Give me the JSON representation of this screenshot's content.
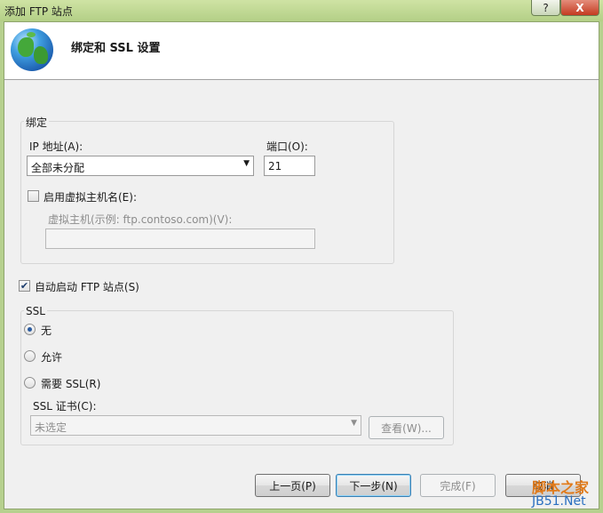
{
  "window": {
    "title": "添加 FTP 站点",
    "help_label": "?",
    "close_label": "X"
  },
  "header": {
    "title": "绑定和 SSL 设置"
  },
  "binding": {
    "group_label": "绑定",
    "ip_label": "IP 地址(A):",
    "ip_value": "全部未分配",
    "port_label": "端口(O):",
    "port_value": "21",
    "enable_virtual_host_label": "启用虚拟主机名(E):",
    "enable_virtual_host_checked": false,
    "virtual_host_label": "虚拟主机(示例: ftp.contoso.com)(V):",
    "virtual_host_value": ""
  },
  "auto_start": {
    "label": "自动启动 FTP 站点(S)",
    "checked": true
  },
  "ssl": {
    "group_label": "SSL",
    "options": [
      {
        "label": "无",
        "selected": true
      },
      {
        "label": "允许",
        "selected": false
      },
      {
        "label": "需要 SSL(R)",
        "selected": false
      }
    ],
    "cert_label": "SSL 证书(C):",
    "cert_value": "未选定",
    "view_button": "查看(W)..."
  },
  "footer": {
    "prev_button": "上一页(P)",
    "next_button": "下一步(N)",
    "finish_button": "完成(F)",
    "cancel_button": "取消"
  },
  "watermark": {
    "line1": "脚本之家",
    "line2": "JB51.Net"
  }
}
